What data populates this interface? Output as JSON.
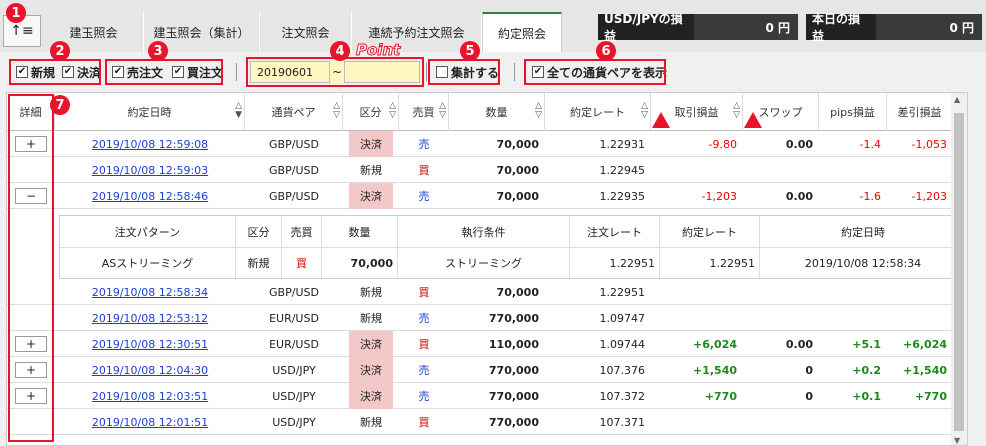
{
  "tabs": [
    {
      "label": "建玉照会"
    },
    {
      "label": "建玉照会（集計）"
    },
    {
      "label": "注文照会"
    },
    {
      "label": "連続予約注文照会"
    },
    {
      "label": "約定照会"
    }
  ],
  "pl": {
    "usdjpy_label": "USD/JPYの損益",
    "usdjpy_value": "0 円",
    "today_label": "本日の損益",
    "today_value": "0 円"
  },
  "filters": {
    "new": "新規",
    "settle": "決済",
    "sell": "売注文",
    "buy": "買注文",
    "date_from": "20190601",
    "tilde": "~",
    "aggregate": "集計する",
    "all_pairs": "全ての通貨ペアを表示"
  },
  "annot": {
    "n1": "1",
    "n2": "2",
    "n3": "3",
    "n4": "4",
    "n5": "5",
    "n6": "6",
    "n7": "7",
    "point": "Point"
  },
  "headers": {
    "detail": "詳細",
    "datetime": "約定日時",
    "pair": "通貨ペア",
    "kbn": "区分",
    "side": "売買",
    "qty": "数量",
    "rate": "約定レート",
    "pl": "取引損益",
    "swap": "スワップ",
    "pips": "pips損益",
    "net": "差引損益"
  },
  "rows": [
    {
      "btn": "+",
      "dt": "2019/10/08 12:59:08",
      "pair": "GBP/USD",
      "kbn": "決済",
      "side": "売",
      "qty": "70,000",
      "rate": "1.22931",
      "pl": "-9.80",
      "swap": "0.00",
      "pips": "-1.4",
      "net": "-1,053"
    },
    {
      "btn": "",
      "dt": "2019/10/08 12:59:03",
      "pair": "GBP/USD",
      "kbn": "新規",
      "side": "買",
      "qty": "70,000",
      "rate": "1.22945",
      "pl": "",
      "swap": "",
      "pips": "",
      "net": ""
    },
    {
      "btn": "−",
      "dt": "2019/10/08 12:58:46",
      "pair": "GBP/USD",
      "kbn": "決済",
      "side": "売",
      "qty": "70,000",
      "rate": "1.22935",
      "pl": "-1,203",
      "swap": "0.00",
      "pips": "-1.6",
      "net": "-1,203"
    },
    {
      "btn": "",
      "dt": "2019/10/08 12:58:34",
      "pair": "GBP/USD",
      "kbn": "新規",
      "side": "買",
      "qty": "70,000",
      "rate": "1.22951",
      "pl": "",
      "swap": "",
      "pips": "",
      "net": ""
    },
    {
      "btn": "",
      "dt": "2019/10/08 12:53:12",
      "pair": "EUR/USD",
      "kbn": "新規",
      "side": "売",
      "qty": "770,000",
      "rate": "1.09747",
      "pl": "",
      "swap": "",
      "pips": "",
      "net": ""
    },
    {
      "btn": "+",
      "dt": "2019/10/08 12:30:51",
      "pair": "EUR/USD",
      "kbn": "決済",
      "side": "買",
      "qty": "110,000",
      "rate": "1.09744",
      "pl": "+6,024",
      "swap": "0.00",
      "pips": "+5.1",
      "net": "+6,024"
    },
    {
      "btn": "+",
      "dt": "2019/10/08 12:04:30",
      "pair": "USD/JPY",
      "kbn": "決済",
      "side": "売",
      "qty": "770,000",
      "rate": "107.376",
      "pl": "+1,540",
      "swap": "0",
      "pips": "+0.2",
      "net": "+1,540"
    },
    {
      "btn": "+",
      "dt": "2019/10/08 12:03:51",
      "pair": "USD/JPY",
      "kbn": "決済",
      "side": "売",
      "qty": "770,000",
      "rate": "107.372",
      "pl": "+770",
      "swap": "0",
      "pips": "+0.1",
      "net": "+770"
    },
    {
      "btn": "",
      "dt": "2019/10/08 12:01:51",
      "pair": "USD/JPY",
      "kbn": "新規",
      "side": "買",
      "qty": "770,000",
      "rate": "107.371",
      "pl": "",
      "swap": "",
      "pips": "",
      "net": ""
    }
  ],
  "sub": {
    "h_pattern": "注文パターン",
    "h_kbn": "区分",
    "h_side": "売買",
    "h_qty": "数量",
    "h_cond": "執行条件",
    "h_orate": "注文レート",
    "h_rate": "約定レート",
    "h_dt": "約定日時",
    "pattern": "ASストリーミング",
    "kbn": "新規",
    "side": "買",
    "qty": "70,000",
    "cond": "ストリーミング",
    "orate": "1.22951",
    "rate": "1.22951",
    "dt": "2019/10/08 12:58:34"
  },
  "colors": {
    "accent": "#e8142a",
    "buy": "#d40000",
    "sell": "#1a3fd1",
    "settle_bg": "#f2c8c8"
  }
}
